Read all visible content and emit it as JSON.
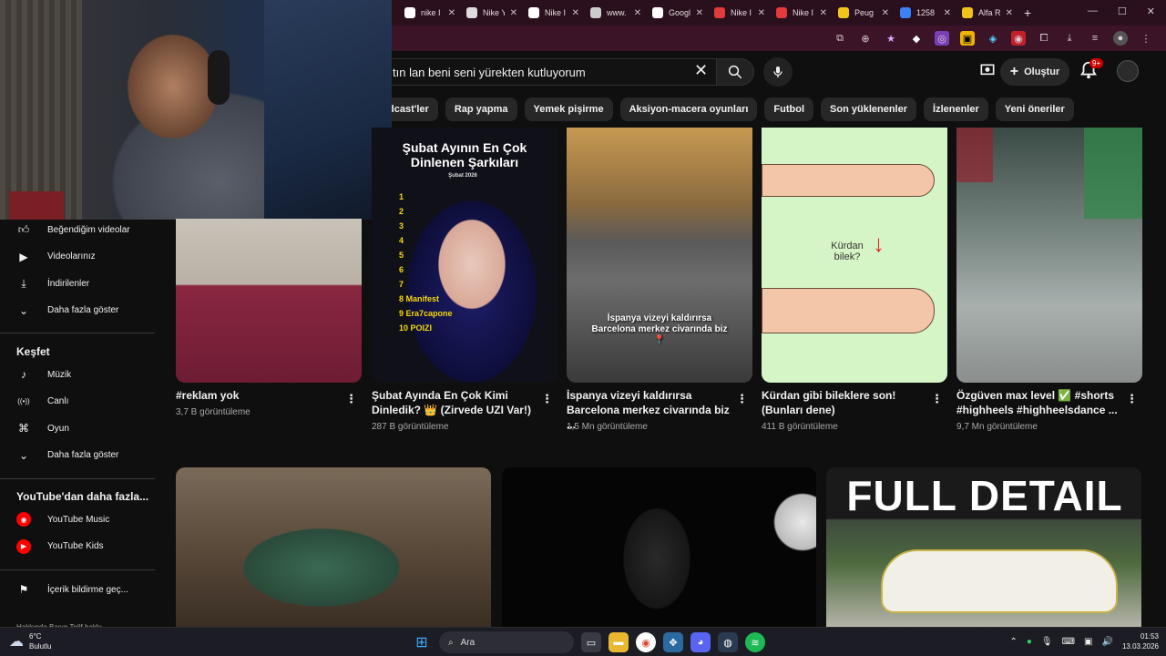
{
  "browser": {
    "tabs": [
      {
        "label": "nike I",
        "icon": "google-icon",
        "color": "#ffffff"
      },
      {
        "label": "Nike Y",
        "icon": "doc-icon",
        "color": "#dddddd"
      },
      {
        "label": "Nike I",
        "icon": "globe-icon",
        "color": "#ffffff"
      },
      {
        "label": "www.",
        "icon": "globe-icon",
        "color": "#cccccc"
      },
      {
        "label": "Googl",
        "icon": "google-icon",
        "color": "#ffffff"
      },
      {
        "label": "Nike I",
        "icon": "nike-icon",
        "color": "#e23b3b"
      },
      {
        "label": "Nike I",
        "icon": "nike-icon",
        "color": "#e23b3b"
      },
      {
        "label": "Peug",
        "icon": "s-icon",
        "color": "#f0c419"
      },
      {
        "label": "1258",
        "icon": "globe-icon",
        "color": "#3b82f6"
      },
      {
        "label": "Alfa R",
        "icon": "s-icon",
        "color": "#f0c419"
      }
    ],
    "new_tab": "+"
  },
  "header": {
    "search_value": "tın lan beni seni yürekten kutluyorum",
    "create_label": "Oluştur",
    "notification_count": "9+"
  },
  "chips": [
    "dcast'ler",
    "Rap yapma",
    "Yemek pişirme",
    "Aksiyon-macera oyunları",
    "Futbol",
    "Son yüklenenler",
    "İzlenenler",
    "Yeni öneriler"
  ],
  "sidebar": {
    "items_top": [
      {
        "label": "Beğendiğim videolar",
        "icon": "thumbs-up-icon"
      },
      {
        "label": "Videolarınız",
        "icon": "play-square-icon"
      },
      {
        "label": "İndirilenler",
        "icon": "download-icon"
      },
      {
        "label": "Daha fazla göster",
        "icon": "chevron-down-icon"
      }
    ],
    "explore_title": "Keşfet",
    "explore_items": [
      {
        "label": "Müzik",
        "icon": "music-note-icon"
      },
      {
        "label": "Canlı",
        "icon": "live-icon"
      },
      {
        "label": "Oyun",
        "icon": "gamepad-icon"
      },
      {
        "label": "Daha fazla göster",
        "icon": "chevron-down-icon"
      }
    ],
    "more_title": "YouTube'dan daha fazla...",
    "more_items": [
      {
        "label": "YouTube Music",
        "icon": "youtube-music-icon"
      },
      {
        "label": "YouTube Kids",
        "icon": "youtube-kids-icon"
      }
    ],
    "report_label": "İçerik bildirme geç...",
    "footer": "Hakkında  Basın  Telif hakkı"
  },
  "videos_row1": [
    {
      "title_line1": "#reklam yok",
      "title_line2": "",
      "views": "3,7 B görüntüleme"
    },
    {
      "title_line1": "Şubat Ayında En Çok Kimi",
      "title_line2": "Dinledik? 👑 (Zirvede UZI Var!)",
      "views": "287 B görüntüleme"
    },
    {
      "title_line1": "İspanya vizeyi kaldırırsa",
      "title_line2": "Barcelona merkez civarında biz ...",
      "views": "1,5 Mn görüntüleme"
    },
    {
      "title_line1": "Kürdan gibi bileklere son!",
      "title_line2": "(Bunları dene)",
      "views": "411 B görüntüleme"
    },
    {
      "title_line1": "Özgüven max level ✅ #shorts",
      "title_line2": "#highheels #highheelsdance ...",
      "views": "9,7 Mn görüntüleme"
    }
  ],
  "thumb_texts": {
    "subat_title": "Şubat Ayının En Çok Dinlenen Şarkıları",
    "subat_year": "Şubat 2026",
    "subat_list": [
      "1",
      "2",
      "3",
      "4",
      "5",
      "6",
      "7",
      "8 Manifest",
      "9 Era7capone",
      "10 POIZI"
    ],
    "ispanya_caption": "İspanya vizeyi kaldırırsa Barcelona merkez civarında biz 📍",
    "kurdan_text": "Kürdan bilek?",
    "full_detail": "FULL DETAIL"
  },
  "taskbar": {
    "temp": "6°C",
    "weather": "Bulutlu",
    "search": "Ara",
    "time": "01:53",
    "date": "13.03.2026"
  }
}
